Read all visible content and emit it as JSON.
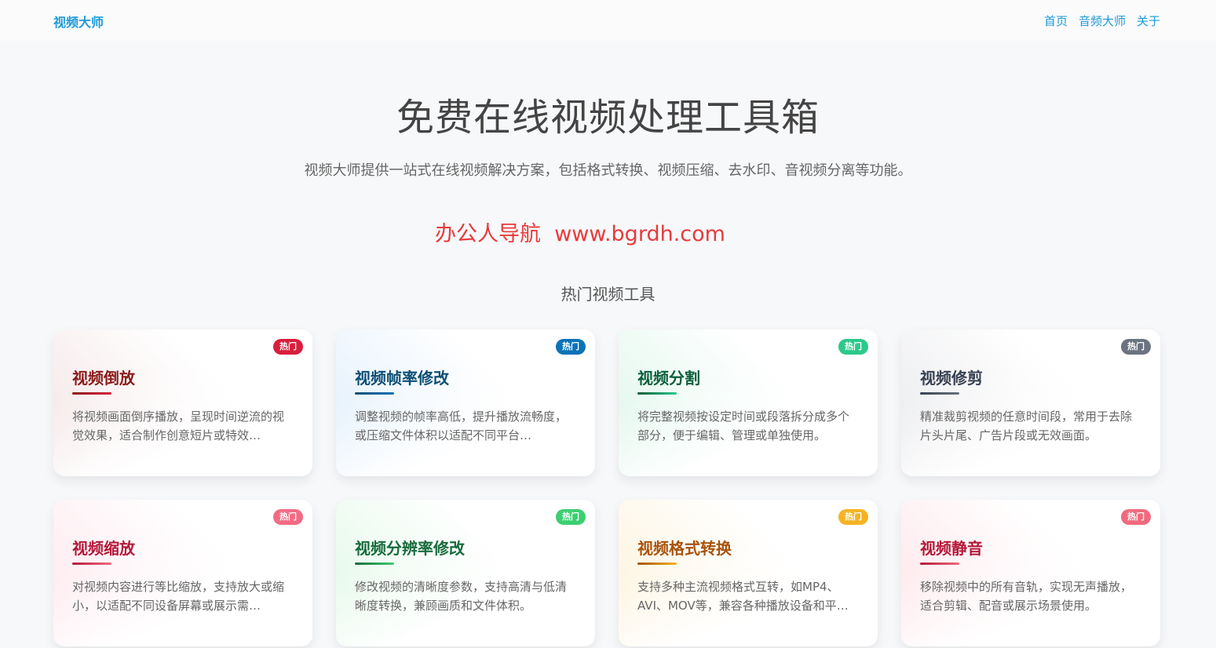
{
  "nav": {
    "brand": "视频大师",
    "links": [
      "首页",
      "音频大师",
      "关于"
    ]
  },
  "hero": {
    "title": "免费在线视频处理工具箱",
    "subtitle": "视频大师提供一站式在线视频解决方案，包括格式转换、视频压缩、去水印、音视频分离等功能。",
    "promo": "办公人导航  www.bgrdh.com"
  },
  "section": {
    "title": "热门视频工具"
  },
  "cards": [
    {
      "title": "视频倒放",
      "desc": "将视频画面倒序播放，呈现时间逆流的视觉效果，适合制作创意短片或特效…",
      "badge": "热门",
      "accent": "#8b1a1a",
      "badge_color": "#d81e3c",
      "bg_tint": "#f3e4e4"
    },
    {
      "title": "视频帧率修改",
      "desc": "调整视频的帧率高低，提升播放流畅度，或压缩文件体积以适配不同平台…",
      "badge": "热门",
      "accent": "#0d4e73",
      "badge_color": "#0a73b8",
      "bg_tint": "#dfeefc"
    },
    {
      "title": "视频分割",
      "desc": "将完整视频按设定时间或段落拆分成多个部分，便于编辑、管理或单独使用。",
      "badge": "热门",
      "accent": "#0b5e3a",
      "badge_color": "#2cc98b",
      "bg_tint": "#dcf6ea"
    },
    {
      "title": "视频修剪",
      "desc": "精准裁剪视频的任意时间段，常用于去除片头片尾、广告片段或无效画面。",
      "badge": "热门",
      "accent": "#374151",
      "badge_color": "#6b7280",
      "bg_tint": "#e8e9ec"
    },
    {
      "title": "视频缩放",
      "desc": "对视频内容进行等比缩放，支持放大或缩小，以适配不同设备屏幕或展示需…",
      "badge": "热门",
      "accent": "#b4193a",
      "badge_color": "#f26b83",
      "bg_tint": "#fde6ec"
    },
    {
      "title": "视频分辨率修改",
      "desc": "修改视频的清晰度参数，支持高清与低清晰度转换，兼顾画质和文件体积。",
      "badge": "热门",
      "accent": "#176b3c",
      "badge_color": "#3ccf72",
      "bg_tint": "#e0f8e6"
    },
    {
      "title": "视频格式转换",
      "desc": "支持多种主流视频格式互转，如MP4、AVI、MOV等，兼容各种播放设备和平…",
      "badge": "热门",
      "accent": "#a8520c",
      "badge_color": "#f5b324",
      "bg_tint": "#fdf2d9"
    },
    {
      "title": "视频静音",
      "desc": "移除视频中的所有音轨，实现无声播放，适合剪辑、配音或展示场景使用。",
      "badge": "热门",
      "accent": "#b4193a",
      "badge_color": "#f06a7e",
      "bg_tint": "#fde4e8"
    }
  ]
}
